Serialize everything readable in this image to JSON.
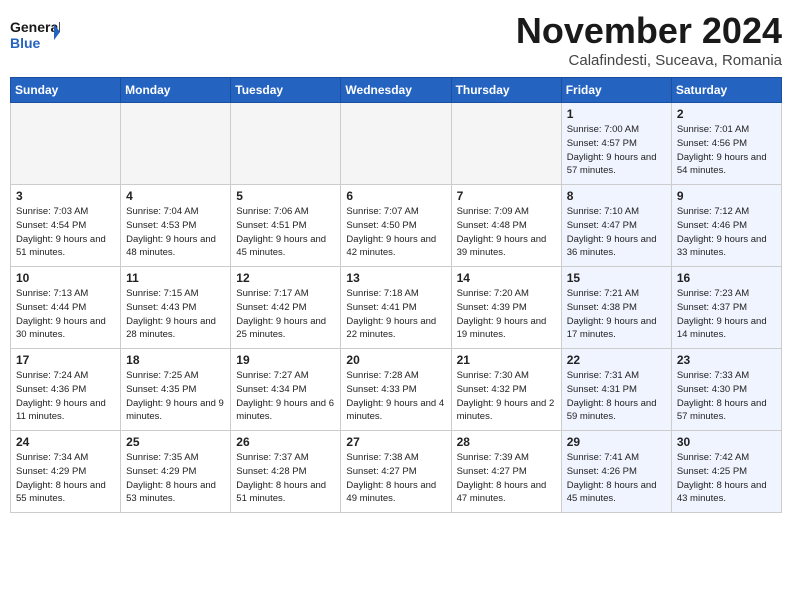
{
  "logo": {
    "line1": "General",
    "line2": "Blue"
  },
  "title": "November 2024",
  "subtitle": "Calafindesti, Suceava, Romania",
  "weekdays": [
    "Sunday",
    "Monday",
    "Tuesday",
    "Wednesday",
    "Thursday",
    "Friday",
    "Saturday"
  ],
  "weeks": [
    [
      {
        "num": "",
        "info": ""
      },
      {
        "num": "",
        "info": ""
      },
      {
        "num": "",
        "info": ""
      },
      {
        "num": "",
        "info": ""
      },
      {
        "num": "",
        "info": ""
      },
      {
        "num": "1",
        "info": "Sunrise: 7:00 AM\nSunset: 4:57 PM\nDaylight: 9 hours and 57 minutes."
      },
      {
        "num": "2",
        "info": "Sunrise: 7:01 AM\nSunset: 4:56 PM\nDaylight: 9 hours and 54 minutes."
      }
    ],
    [
      {
        "num": "3",
        "info": "Sunrise: 7:03 AM\nSunset: 4:54 PM\nDaylight: 9 hours and 51 minutes."
      },
      {
        "num": "4",
        "info": "Sunrise: 7:04 AM\nSunset: 4:53 PM\nDaylight: 9 hours and 48 minutes."
      },
      {
        "num": "5",
        "info": "Sunrise: 7:06 AM\nSunset: 4:51 PM\nDaylight: 9 hours and 45 minutes."
      },
      {
        "num": "6",
        "info": "Sunrise: 7:07 AM\nSunset: 4:50 PM\nDaylight: 9 hours and 42 minutes."
      },
      {
        "num": "7",
        "info": "Sunrise: 7:09 AM\nSunset: 4:48 PM\nDaylight: 9 hours and 39 minutes."
      },
      {
        "num": "8",
        "info": "Sunrise: 7:10 AM\nSunset: 4:47 PM\nDaylight: 9 hours and 36 minutes."
      },
      {
        "num": "9",
        "info": "Sunrise: 7:12 AM\nSunset: 4:46 PM\nDaylight: 9 hours and 33 minutes."
      }
    ],
    [
      {
        "num": "10",
        "info": "Sunrise: 7:13 AM\nSunset: 4:44 PM\nDaylight: 9 hours and 30 minutes."
      },
      {
        "num": "11",
        "info": "Sunrise: 7:15 AM\nSunset: 4:43 PM\nDaylight: 9 hours and 28 minutes."
      },
      {
        "num": "12",
        "info": "Sunrise: 7:17 AM\nSunset: 4:42 PM\nDaylight: 9 hours and 25 minutes."
      },
      {
        "num": "13",
        "info": "Sunrise: 7:18 AM\nSunset: 4:41 PM\nDaylight: 9 hours and 22 minutes."
      },
      {
        "num": "14",
        "info": "Sunrise: 7:20 AM\nSunset: 4:39 PM\nDaylight: 9 hours and 19 minutes."
      },
      {
        "num": "15",
        "info": "Sunrise: 7:21 AM\nSunset: 4:38 PM\nDaylight: 9 hours and 17 minutes."
      },
      {
        "num": "16",
        "info": "Sunrise: 7:23 AM\nSunset: 4:37 PM\nDaylight: 9 hours and 14 minutes."
      }
    ],
    [
      {
        "num": "17",
        "info": "Sunrise: 7:24 AM\nSunset: 4:36 PM\nDaylight: 9 hours and 11 minutes."
      },
      {
        "num": "18",
        "info": "Sunrise: 7:25 AM\nSunset: 4:35 PM\nDaylight: 9 hours and 9 minutes."
      },
      {
        "num": "19",
        "info": "Sunrise: 7:27 AM\nSunset: 4:34 PM\nDaylight: 9 hours and 6 minutes."
      },
      {
        "num": "20",
        "info": "Sunrise: 7:28 AM\nSunset: 4:33 PM\nDaylight: 9 hours and 4 minutes."
      },
      {
        "num": "21",
        "info": "Sunrise: 7:30 AM\nSunset: 4:32 PM\nDaylight: 9 hours and 2 minutes."
      },
      {
        "num": "22",
        "info": "Sunrise: 7:31 AM\nSunset: 4:31 PM\nDaylight: 8 hours and 59 minutes."
      },
      {
        "num": "23",
        "info": "Sunrise: 7:33 AM\nSunset: 4:30 PM\nDaylight: 8 hours and 57 minutes."
      }
    ],
    [
      {
        "num": "24",
        "info": "Sunrise: 7:34 AM\nSunset: 4:29 PM\nDaylight: 8 hours and 55 minutes."
      },
      {
        "num": "25",
        "info": "Sunrise: 7:35 AM\nSunset: 4:29 PM\nDaylight: 8 hours and 53 minutes."
      },
      {
        "num": "26",
        "info": "Sunrise: 7:37 AM\nSunset: 4:28 PM\nDaylight: 8 hours and 51 minutes."
      },
      {
        "num": "27",
        "info": "Sunrise: 7:38 AM\nSunset: 4:27 PM\nDaylight: 8 hours and 49 minutes."
      },
      {
        "num": "28",
        "info": "Sunrise: 7:39 AM\nSunset: 4:27 PM\nDaylight: 8 hours and 47 minutes."
      },
      {
        "num": "29",
        "info": "Sunrise: 7:41 AM\nSunset: 4:26 PM\nDaylight: 8 hours and 45 minutes."
      },
      {
        "num": "30",
        "info": "Sunrise: 7:42 AM\nSunset: 4:25 PM\nDaylight: 8 hours and 43 minutes."
      }
    ]
  ]
}
